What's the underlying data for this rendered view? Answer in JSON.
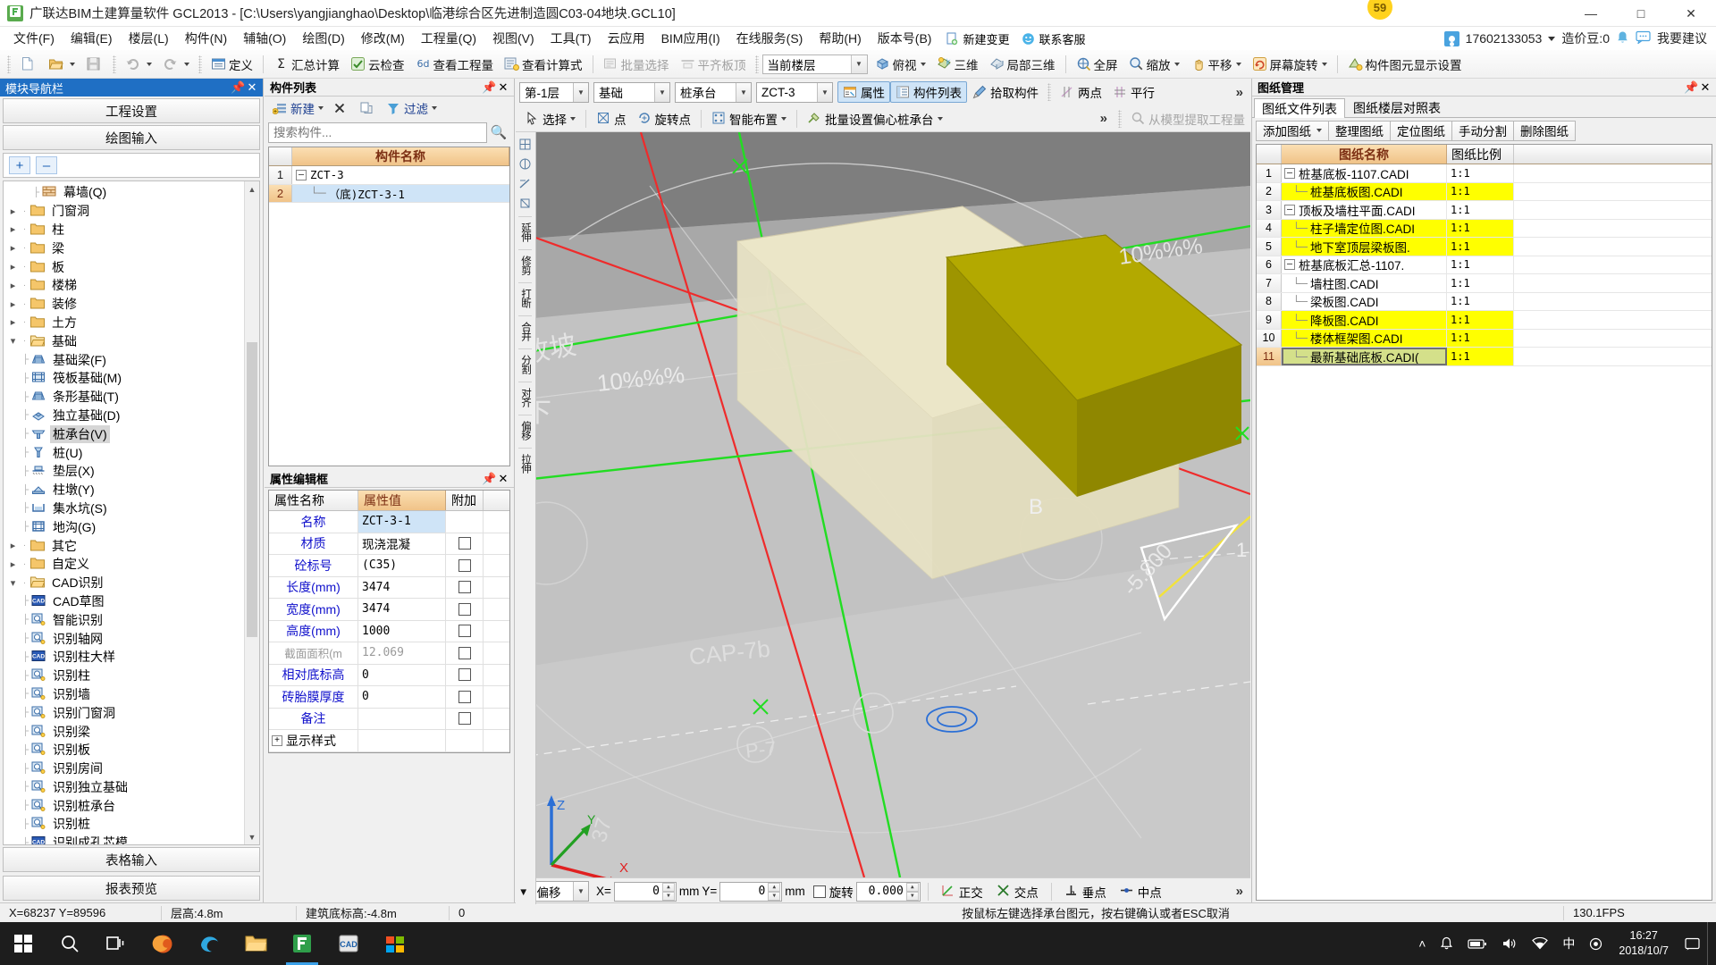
{
  "titlebar": {
    "app_title": "广联达BIM土建算量软件 GCL2013 - [C:\\Users\\yangjianghao\\Desktop\\临港综合区先进制造圆C03-04地块.GCL10]",
    "logo": "app-logo",
    "notification_badge": "59",
    "minimize": "—",
    "maximize": "□",
    "close": "✕"
  },
  "menubar": {
    "items": [
      "文件(F)",
      "编辑(E)",
      "楼层(L)",
      "构件(N)",
      "辅轴(O)",
      "绘图(D)",
      "修改(M)",
      "工程量(Q)",
      "视图(V)",
      "工具(T)",
      "云应用",
      "BIM应用(I)",
      "在线服务(S)",
      "帮助(H)",
      "版本号(B)"
    ],
    "new_change": "新建变更",
    "contact_service": "联系客服",
    "account": {
      "phone": "17602133053",
      "coin_label": "造价豆:0",
      "suggest": "我要建议"
    }
  },
  "toolbar": {
    "new": "new-document",
    "open": "open-folder",
    "save": "save-disk",
    "undo": "undo",
    "redo": "redo",
    "buttons": [
      {
        "label": "定义",
        "icon": "define-icon",
        "disabled": false
      },
      {
        "label": "汇总计算",
        "icon": "sigma-icon",
        "disabled": false
      },
      {
        "label": "云检查",
        "icon": "cloud-check-icon",
        "disabled": false
      },
      {
        "label": "查看工程量",
        "icon": "view-quantity-icon",
        "disabled": false
      },
      {
        "label": "查看计算式",
        "icon": "view-formula-icon",
        "disabled": false
      },
      {
        "label": "批量选择",
        "icon": "batch-select-icon",
        "disabled": true
      },
      {
        "label": "平齐板顶",
        "icon": "align-slab-icon",
        "disabled": true
      }
    ],
    "floor_combo": "当前楼层",
    "view_buttons": [
      {
        "label": "俯视",
        "icon": "top-view-icon",
        "caret": true
      },
      {
        "label": "三维",
        "icon": "3d-icon",
        "caret": false
      },
      {
        "label": "局部三维",
        "icon": "partial-3d-icon",
        "caret": false
      },
      {
        "label": "全屏",
        "icon": "fullscreen-icon",
        "caret": false
      },
      {
        "label": "缩放",
        "icon": "zoom-icon",
        "caret": true
      },
      {
        "label": "平移",
        "icon": "pan-icon",
        "caret": true
      },
      {
        "label": "屏幕旋转",
        "icon": "rotate-screen-icon",
        "caret": true
      },
      {
        "label": "构件图元显示设置",
        "icon": "display-settings-icon",
        "caret": false
      }
    ]
  },
  "leftnav": {
    "title": "模块导航栏",
    "pin": "▾",
    "close": "✕",
    "btn_project_settings": "工程设置",
    "btn_draw_input": "绘图输入",
    "expand_all": "+",
    "collapse_all": "–",
    "btn_table_input": "表格输入",
    "btn_report_preview": "报表预览",
    "tree": [
      {
        "label": "幕墙(Q)",
        "level": 3,
        "type": "leaf",
        "icon": "curtain-wall-icon"
      },
      {
        "label": "门窗洞",
        "level": 1,
        "type": "folder",
        "expanded": false,
        "icon": "folder-icon"
      },
      {
        "label": "柱",
        "level": 1,
        "type": "folder",
        "expanded": false,
        "icon": "folder-icon"
      },
      {
        "label": "梁",
        "level": 1,
        "type": "folder",
        "expanded": false,
        "icon": "folder-icon"
      },
      {
        "label": "板",
        "level": 1,
        "type": "folder",
        "expanded": false,
        "icon": "folder-icon"
      },
      {
        "label": "楼梯",
        "level": 1,
        "type": "folder",
        "expanded": false,
        "icon": "folder-icon"
      },
      {
        "label": "装修",
        "level": 1,
        "type": "folder",
        "expanded": false,
        "icon": "folder-icon"
      },
      {
        "label": "土方",
        "level": 1,
        "type": "folder",
        "expanded": false,
        "icon": "folder-icon"
      },
      {
        "label": "基础",
        "level": 1,
        "type": "folder",
        "expanded": true,
        "icon": "folder-open-icon"
      },
      {
        "label": "基础梁(F)",
        "level": 2,
        "type": "leaf",
        "icon": "foundation-beam-icon"
      },
      {
        "label": "筏板基础(M)",
        "level": 2,
        "type": "leaf",
        "icon": "raft-foundation-icon"
      },
      {
        "label": "条形基础(T)",
        "level": 2,
        "type": "leaf",
        "icon": "strip-foundation-icon"
      },
      {
        "label": "独立基础(D)",
        "level": 2,
        "type": "leaf",
        "icon": "isolated-foundation-icon"
      },
      {
        "label": "桩承台(V)",
        "level": 2,
        "type": "leaf",
        "icon": "pile-cap-icon",
        "selected": true
      },
      {
        "label": "桩(U)",
        "level": 2,
        "type": "leaf",
        "icon": "pile-icon"
      },
      {
        "label": "垫层(X)",
        "level": 2,
        "type": "leaf",
        "icon": "cushion-icon"
      },
      {
        "label": "柱墩(Y)",
        "level": 2,
        "type": "leaf",
        "icon": "column-pier-icon"
      },
      {
        "label": "集水坑(S)",
        "level": 2,
        "type": "leaf",
        "icon": "sump-icon"
      },
      {
        "label": "地沟(G)",
        "level": 2,
        "type": "leaf",
        "icon": "trench-icon"
      },
      {
        "label": "其它",
        "level": 1,
        "type": "folder",
        "expanded": false,
        "icon": "folder-icon"
      },
      {
        "label": "自定义",
        "level": 1,
        "type": "folder",
        "expanded": false,
        "icon": "folder-icon"
      },
      {
        "label": "CAD识别",
        "level": 1,
        "type": "folder",
        "expanded": true,
        "icon": "folder-open-icon"
      },
      {
        "label": "CAD草图",
        "level": 2,
        "type": "leaf",
        "icon": "cad-sketch-icon"
      },
      {
        "label": "智能识别",
        "level": 2,
        "type": "leaf",
        "icon": "smart-recognize-icon"
      },
      {
        "label": "识别轴网",
        "level": 2,
        "type": "leaf",
        "icon": "recognize-grid-icon"
      },
      {
        "label": "识别柱大样",
        "level": 2,
        "type": "leaf",
        "icon": "recognize-column-detail-icon"
      },
      {
        "label": "识别柱",
        "level": 2,
        "type": "leaf",
        "icon": "recognize-column-icon"
      },
      {
        "label": "识别墙",
        "level": 2,
        "type": "leaf",
        "icon": "recognize-wall-icon"
      },
      {
        "label": "识别门窗洞",
        "level": 2,
        "type": "leaf",
        "icon": "recognize-opening-icon"
      },
      {
        "label": "识别梁",
        "level": 2,
        "type": "leaf",
        "icon": "recognize-beam-icon"
      },
      {
        "label": "识别板",
        "level": 2,
        "type": "leaf",
        "icon": "recognize-slab-icon"
      },
      {
        "label": "识别房间",
        "level": 2,
        "type": "leaf",
        "icon": "recognize-room-icon"
      },
      {
        "label": "识别独立基础",
        "level": 2,
        "type": "leaf",
        "icon": "recognize-isolated-foundation-icon"
      },
      {
        "label": "识别桩承台",
        "level": 2,
        "type": "leaf",
        "icon": "recognize-pile-cap-icon"
      },
      {
        "label": "识别桩",
        "level": 2,
        "type": "leaf",
        "icon": "recognize-pile-icon"
      },
      {
        "label": "识别成孔芯模",
        "level": 2,
        "type": "leaf",
        "icon": "recognize-core-mold-icon"
      }
    ]
  },
  "complist": {
    "title": "构件列表",
    "pin": "▾",
    "close": "✕",
    "btn_new": "新建",
    "btn_delete": "delete-x-icon",
    "btn_copy": "copy-icon",
    "btn_filter_icon": "filter-icon",
    "btn_filter": "过滤",
    "search_placeholder": "搜索构件...",
    "search_value": "",
    "search_icon": "search-icon",
    "col_index": "",
    "col_name": "构件名称",
    "rows": [
      {
        "index": "1",
        "name": "ZCT-3",
        "expander": "–",
        "level": 0,
        "selected": false
      },
      {
        "index": "2",
        "name": "（底)ZCT-3-1",
        "expander": "",
        "level": 1,
        "selected": true
      }
    ]
  },
  "propedit": {
    "title": "属性编辑框",
    "pin": "▾",
    "close": "✕",
    "col_name": "属性名称",
    "col_value": "属性值",
    "col_extra": "附加",
    "rows": [
      {
        "name": "名称",
        "value": "ZCT-3-1",
        "checkbox": false,
        "dim": false,
        "value_selected": true
      },
      {
        "name": "材质",
        "value": "现浇混凝",
        "checkbox": true,
        "dim": false,
        "cn": true
      },
      {
        "name": "砼标号",
        "value": "(C35)",
        "checkbox": true,
        "dim": false
      },
      {
        "name": "长度(mm)",
        "value": "3474",
        "checkbox": true,
        "dim": false
      },
      {
        "name": "宽度(mm)",
        "value": "3474",
        "checkbox": true,
        "dim": false
      },
      {
        "name": "高度(mm)",
        "value": "1000",
        "checkbox": true,
        "dim": false
      },
      {
        "name": "截面面积(m",
        "value": "12.069",
        "checkbox": true,
        "dim": true
      },
      {
        "name": "相对底标高",
        "value": "0",
        "checkbox": true,
        "dim": false
      },
      {
        "name": "砖胎膜厚度",
        "value": "0",
        "checkbox": true,
        "dim": false
      },
      {
        "name": "备注",
        "value": "",
        "checkbox": true,
        "dim": false
      },
      {
        "name": "显示样式",
        "value": "",
        "checkbox": false,
        "dim": false,
        "expander": "+"
      }
    ]
  },
  "canvas": {
    "combo_floor": "第-1层",
    "combo_category": "基础",
    "combo_type": "桩承台",
    "combo_component": "ZCT-3",
    "btn_property": "属性",
    "btn_complist": "构件列表",
    "btn_pick": "拾取构件",
    "btn_two_point": "两点",
    "btn_parallel": "平行",
    "overflow": "»",
    "btn_select": "选择",
    "btn_point": "点",
    "btn_rotate_point": "旋转点",
    "btn_smart_layout": "智能布置",
    "btn_batch_eccentric": "批量设置偏心桩承台",
    "btn_extract": "从模型提取工程量",
    "vstrip": [
      "延伸",
      "修剪",
      "打断",
      "合并",
      "分割",
      "对齐",
      "偏移",
      "拉伸"
    ],
    "bottom": {
      "offset_mode": "不偏移",
      "x_label": "X=",
      "x_value": "0",
      "unit1": "mm",
      "y_label": "Y=",
      "y_value": "0",
      "unit2": "mm",
      "rotate_label": "旋转",
      "rotate_value": "0.000",
      "snap_ortho": "正交",
      "snap_intersect": "交点",
      "snap_perp": "垂点",
      "snap_mid": "中点",
      "more": "»"
    },
    "model_labels": {
      "slope_left": "10%%%",
      "slope_right": "10%%%",
      "slope_text": "放坡",
      "below": "下",
      "cap_tag": "CAP-7b",
      "pile_tag": "P-7",
      "elev": "-5.800",
      "axis_b": "B",
      "axis_num": "37",
      "axis_1": "1"
    }
  },
  "rightpanel": {
    "title": "图纸管理",
    "pin": "▾",
    "close": "✕",
    "tabs": [
      {
        "label": "图纸文件列表",
        "active": true
      },
      {
        "label": "图纸楼层对照表",
        "active": false
      }
    ],
    "buttons": [
      "添加图纸",
      "整理图纸",
      "定位图纸",
      "手动分割",
      "删除图纸"
    ],
    "add_caret": "▾",
    "col_index": "",
    "col_name": "图纸名称",
    "col_scale": "图纸比例",
    "rows": [
      {
        "index": "1",
        "name": "桩基底板-1107.CADI",
        "scale": "1:1",
        "level": 0,
        "expander": "–",
        "highlight": false,
        "current": false
      },
      {
        "index": "2",
        "name": "桩基底板图.CADI",
        "scale": "1:1",
        "level": 1,
        "expander": "",
        "highlight": true,
        "current": false
      },
      {
        "index": "3",
        "name": "顶板及墙柱平面.CADI",
        "scale": "1:1",
        "level": 0,
        "expander": "–",
        "highlight": false,
        "current": false
      },
      {
        "index": "4",
        "name": "柱子墙定位图.CADI",
        "scale": "1:1",
        "level": 1,
        "expander": "",
        "highlight": true,
        "current": false
      },
      {
        "index": "5",
        "name": "地下室顶层梁板图.",
        "scale": "1:1",
        "level": 1,
        "expander": "",
        "highlight": true,
        "current": false
      },
      {
        "index": "6",
        "name": "桩基底板汇总-1107.",
        "scale": "1:1",
        "level": 0,
        "expander": "–",
        "highlight": false,
        "current": false
      },
      {
        "index": "7",
        "name": "墙柱图.CADI",
        "scale": "1:1",
        "level": 1,
        "expander": "",
        "highlight": false,
        "current": false
      },
      {
        "index": "8",
        "name": "梁板图.CADI",
        "scale": "1:1",
        "level": 1,
        "expander": "",
        "highlight": false,
        "current": false
      },
      {
        "index": "9",
        "name": "降板图.CADI",
        "scale": "1:1",
        "level": 1,
        "expander": "",
        "highlight": true,
        "current": false
      },
      {
        "index": "10",
        "name": "楼体框架图.CADI",
        "scale": "1:1",
        "level": 1,
        "expander": "",
        "highlight": true,
        "current": false
      },
      {
        "index": "11",
        "name": "最新基础底板.CADI(",
        "scale": "1:1",
        "level": 1,
        "expander": "",
        "highlight": true,
        "current": true
      }
    ]
  },
  "statusbar": {
    "coords": "X=68237 Y=89596",
    "floor_height": "层高:4.8m",
    "base_elev": "建筑底标高:-4.8m",
    "value_zero": "0",
    "hint": "按鼠标左键选择承台图元，按右键确认或者ESC取消",
    "fps": "130.1FPS"
  },
  "taskbar": {
    "start": "start-button",
    "icons": [
      {
        "name": "search-icon",
        "glyph": "○"
      },
      {
        "name": "task-view-icon",
        "glyph": "▣"
      },
      {
        "name": "browser-icon",
        "glyph": "❀"
      },
      {
        "name": "edge-icon",
        "glyph": "◔"
      },
      {
        "name": "file-explorer-icon",
        "glyph": "▰"
      },
      {
        "name": "gcl-app-icon",
        "glyph": "▌"
      },
      {
        "name": "cad-app-icon",
        "glyph": "▤"
      },
      {
        "name": "store-icon",
        "glyph": "❖"
      }
    ],
    "tray": {
      "up_arrow": "˄",
      "notif": "🔔",
      "battery": "▭",
      "volume": "🔊",
      "network": "◕",
      "lang_cn": "中",
      "ime": "●"
    },
    "clock_time": "16:27",
    "clock_date": "2018/10/7"
  }
}
